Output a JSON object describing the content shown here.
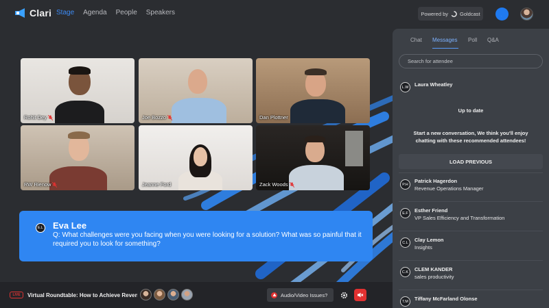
{
  "nav": {
    "brand": "Clari",
    "items": [
      "Stage",
      "Agenda",
      "People",
      "Speakers"
    ],
    "active": "Stage",
    "powered_by": "Powered by",
    "powered_brand": "Goldcast"
  },
  "videos": [
    {
      "name": "Rohit Dey",
      "muted": true
    },
    {
      "name": "Joe Bozzo",
      "muted": true
    },
    {
      "name": "Dan Plottner",
      "muted": false
    },
    {
      "name": "RW Rienow",
      "muted": true
    },
    {
      "name": "Jeanne Ford",
      "muted": false
    },
    {
      "name": "Zack Woods",
      "muted": true
    }
  ],
  "question": {
    "initials": "E.L",
    "author": "Eva Lee",
    "text": "Q: What challenges were you facing when you were looking for a solution? What was so painful that it required you to look for something?"
  },
  "bottom": {
    "live_badge": "LIVE",
    "session_title": "Virtual Roundtable: How to Achieve Reven...",
    "av_issues": "Audio/Video Issues?"
  },
  "panel": {
    "tabs": [
      "Chat",
      "Messages",
      "Poll",
      "Q&A"
    ],
    "active_tab": "Messages",
    "search_placeholder": "Search for attendee",
    "current_contact": {
      "initials": "L.W",
      "name": "Laura Wheatley"
    },
    "status": "Up to date",
    "suggestion": "Start a new conversation, We think you'll enjoy chatting with these recommended attendees!",
    "load_previous": "LOAD PREVIOUS",
    "attendees": [
      {
        "initials": "P.H",
        "name": "Patrick Hagerdon",
        "title": "Revenue Operations Manager"
      },
      {
        "initials": "E.F",
        "name": "Esther Friend",
        "title": "VP Sales Efficiency and Transformation"
      },
      {
        "initials": "C.L",
        "name": "Clay Lemon",
        "title": "Insights"
      },
      {
        "initials": "C.K",
        "name": "CLEM KANDER",
        "title": "sales productivity"
      },
      {
        "initials": "T.M",
        "name": "Tiffany McFarland Olonse",
        "title": ""
      }
    ]
  },
  "colors": {
    "accent": "#2f86f2",
    "background": "#2b2d31",
    "panel": "#3c4046",
    "danger": "#e23131"
  }
}
